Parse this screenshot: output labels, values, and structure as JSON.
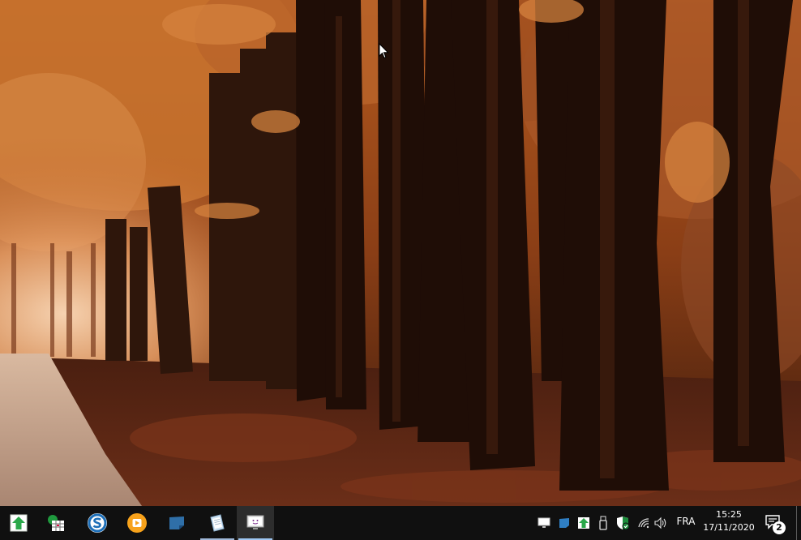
{
  "desktop": {
    "wallpaper": "autumn-forest-path",
    "accent_colors": {
      "foliage": "#c46a2c",
      "trunk": "#221008",
      "ground": "#5e2a18",
      "path": "#b99a85"
    }
  },
  "taskbar": {
    "background": "#101010",
    "pinned_apps": [
      {
        "name": "app-green-arrow",
        "icon": "green-up-arrow-icon",
        "running": false,
        "active": false
      },
      {
        "name": "app-spreadsheet",
        "icon": "spreadsheet-icon",
        "running": false,
        "active": false
      },
      {
        "name": "app-sync",
        "icon": "blue-s-circle-icon",
        "running": false,
        "active": false
      },
      {
        "name": "app-media",
        "icon": "orange-play-circle-icon",
        "running": false,
        "active": false
      },
      {
        "name": "app-notes",
        "icon": "blue-note-icon",
        "running": false,
        "active": false
      },
      {
        "name": "app-document",
        "icon": "document-icon",
        "running": true,
        "active": false
      },
      {
        "name": "app-display",
        "icon": "monitor-icon",
        "running": true,
        "active": true
      }
    ],
    "tray": {
      "icons": [
        {
          "name": "tray-monitor",
          "icon": "monitor-icon"
        },
        {
          "name": "tray-blue-app",
          "icon": "blue-square-icon"
        },
        {
          "name": "tray-green-arrow",
          "icon": "green-up-arrow-icon"
        },
        {
          "name": "tray-usb",
          "icon": "usb-drive-icon"
        },
        {
          "name": "tray-security",
          "icon": "shield-check-icon"
        },
        {
          "name": "tray-network",
          "icon": "wifi-icon"
        },
        {
          "name": "tray-volume",
          "icon": "volume-icon"
        }
      ],
      "language": "FRA",
      "time": "15:25",
      "date": "17/11/2020",
      "notifications_count": "2"
    }
  }
}
